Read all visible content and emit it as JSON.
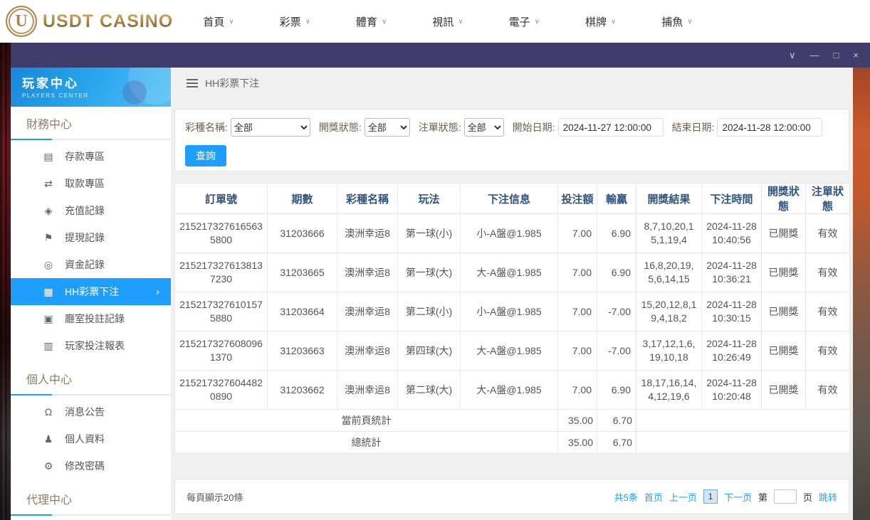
{
  "colors": {
    "accent": "#1e9fff",
    "titlebar_bg": "#413c6a",
    "brand_gold": "#a8854c",
    "sidebar_header_blue": "#2da8ef"
  },
  "brand": {
    "logo_letter": "U",
    "name": "USDT CASINO"
  },
  "topnav": {
    "caret": "∨",
    "items": [
      {
        "label": "首頁"
      },
      {
        "label": "彩票"
      },
      {
        "label": "體育"
      },
      {
        "label": "視訊"
      },
      {
        "label": "電子"
      },
      {
        "label": "棋牌"
      },
      {
        "label": "捕魚"
      }
    ]
  },
  "titlebar": {
    "collapse_icon": "∨",
    "minimize_icon": "—",
    "maximize_icon": "□",
    "close_icon": "×"
  },
  "sidebar": {
    "title": "玩家中心",
    "subtitle": "PLAYERS CENTER",
    "finance": {
      "title": "財務中心",
      "items": [
        {
          "label": "存款專區",
          "icon": "▤"
        },
        {
          "label": "取款專區",
          "icon": "⇄"
        },
        {
          "label": "充值記錄",
          "icon": "◈"
        },
        {
          "label": "提現記錄",
          "icon": "⚑"
        },
        {
          "label": "資金記錄",
          "icon": "◎"
        },
        {
          "label": "HH彩票下注",
          "icon": "▦",
          "chevron": "›"
        },
        {
          "label": "廳室投註記錄",
          "icon": "▣"
        },
        {
          "label": "玩家投注報表",
          "icon": "▥"
        }
      ]
    },
    "personal": {
      "title": "個人中心",
      "items": [
        {
          "label": "消息公告",
          "icon": "Ω"
        },
        {
          "label": "個人資料",
          "icon": "♟"
        },
        {
          "label": "修改密碼",
          "icon": "⚙"
        }
      ]
    },
    "agent": {
      "title": "代理中心"
    }
  },
  "main": {
    "breadcrumb": "HH彩票下注",
    "filters": {
      "lottery_label": "彩種名稱:",
      "lottery_value": "全部",
      "draw_label": "開獎狀態:",
      "draw_value": "全部",
      "order_label": "注單狀態:",
      "order_value": "全部",
      "start_label": "開始日期:",
      "start_value": "2024-11-27 12:00:00",
      "end_label": "結束日期:",
      "end_value": "2024-11-28 12:00:00",
      "query": "查詢"
    },
    "table": {
      "headers": [
        "訂單號",
        "期數",
        "彩種名稱",
        "玩法",
        "下注信息",
        "投注額",
        "輸贏",
        "開獎結果",
        "下注時間",
        "開獎狀態",
        "注單狀態"
      ],
      "rows": [
        [
          "2152173276165635800",
          "31203666",
          "澳洲幸运8",
          "第一球(小)",
          "小-A盤@1.985",
          "7.00",
          "6.90",
          "8,7,10,20,15,1,19,4",
          "2024-11-28 10:40:56",
          "已開獎",
          "有效"
        ],
        [
          "2152173276138137230",
          "31203665",
          "澳洲幸运8",
          "第一球(大)",
          "大-A盤@1.985",
          "7.00",
          "6.90",
          "16,8,20,19,5,6,14,15",
          "2024-11-28 10:36:21",
          "已開獎",
          "有效"
        ],
        [
          "2152173276101575880",
          "31203664",
          "澳洲幸运8",
          "第二球(小)",
          "小-A盤@1.985",
          "7.00",
          "-7.00",
          "15,20,12,8,19,4,18,2",
          "2024-11-28 10:30:15",
          "已開獎",
          "有效"
        ],
        [
          "2152173276080961370",
          "31203663",
          "澳洲幸运8",
          "第四球(大)",
          "大-A盤@1.985",
          "7.00",
          "-7.00",
          "3,17,12,1,6,19,10,18",
          "2024-11-28 10:26:49",
          "已開獎",
          "有效"
        ],
        [
          "2152173276044820890",
          "31203662",
          "澳洲幸运8",
          "第二球(大)",
          "大-A盤@1.985",
          "7.00",
          "6.90",
          "18,17,16,14,4,12,19,6",
          "2024-11-28 10:20:48",
          "已開獎",
          "有效"
        ]
      ],
      "summary": [
        {
          "label": "當前頁統計",
          "bet": "35.00",
          "winloss": "6.70"
        },
        {
          "label": "總統計",
          "bet": "35.00",
          "winloss": "6.70"
        }
      ]
    },
    "pagination": {
      "per_page": "每頁顯示20條",
      "total": "共5条",
      "first": "首页",
      "prev": "上一页",
      "current": "1",
      "next": "下一页",
      "jump_prefix": "第",
      "jump_suffix": "页",
      "jump": "跳转"
    }
  }
}
